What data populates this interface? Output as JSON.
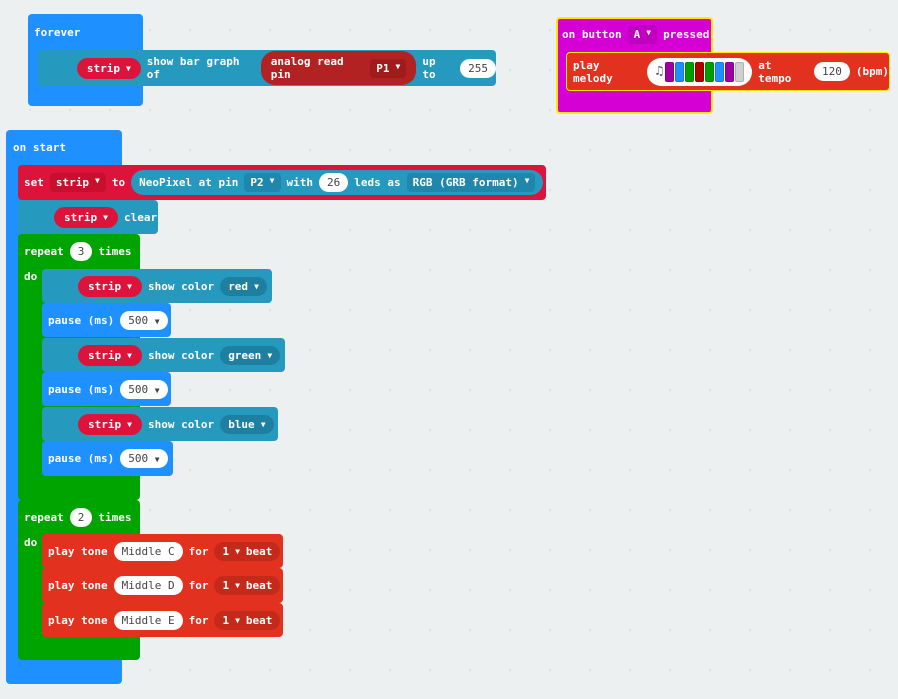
{
  "forever": {
    "label": "forever",
    "block": {
      "var": "strip",
      "text": "show bar graph of",
      "pin_block": "analog read pin",
      "pin": "P1",
      "up_to": "up to",
      "max": "255"
    }
  },
  "on_button": {
    "on": "on button",
    "button": "A",
    "pressed": "pressed",
    "melody": {
      "label": "play melody",
      "notes_colors": [
        "#a000a0",
        "#1e90ff",
        "#00a000",
        "#b00000",
        "#00a000",
        "#1e90ff",
        "#a000a0",
        "#d0d0d0"
      ],
      "at_tempo": "at tempo",
      "tempo": "120",
      "unit": "(bpm)"
    }
  },
  "on_start": {
    "label": "on start",
    "set": {
      "set": "set",
      "var": "strip",
      "to": "to",
      "neo": "NeoPixel at pin",
      "pin": "P2",
      "with": "with",
      "leds": "26",
      "leds_as": "leds as",
      "format": "RGB (GRB format)"
    },
    "clear": {
      "var": "strip",
      "text": "clear"
    },
    "repeat1": {
      "repeat": "repeat",
      "count": "3",
      "times": "times",
      "do": "do",
      "items": [
        {
          "var": "strip",
          "text": "show color",
          "color": "red"
        },
        {
          "pause": "pause (ms)",
          "ms": "500"
        },
        {
          "var": "strip",
          "text": "show color",
          "color": "green"
        },
        {
          "pause": "pause (ms)",
          "ms": "500"
        },
        {
          "var": "strip",
          "text": "show color",
          "color": "blue"
        },
        {
          "pause": "pause (ms)",
          "ms": "500"
        }
      ]
    },
    "repeat2": {
      "repeat": "repeat",
      "count": "2",
      "times": "times",
      "do": "do",
      "tones": [
        {
          "label": "play tone",
          "note": "Middle C",
          "for": "for",
          "beat": "1",
          "unit": "beat"
        },
        {
          "label": "play tone",
          "note": "Middle D",
          "for": "for",
          "beat": "1",
          "unit": "beat"
        },
        {
          "label": "play tone",
          "note": "Middle E",
          "for": "for",
          "beat": "1",
          "unit": "beat"
        }
      ]
    }
  }
}
